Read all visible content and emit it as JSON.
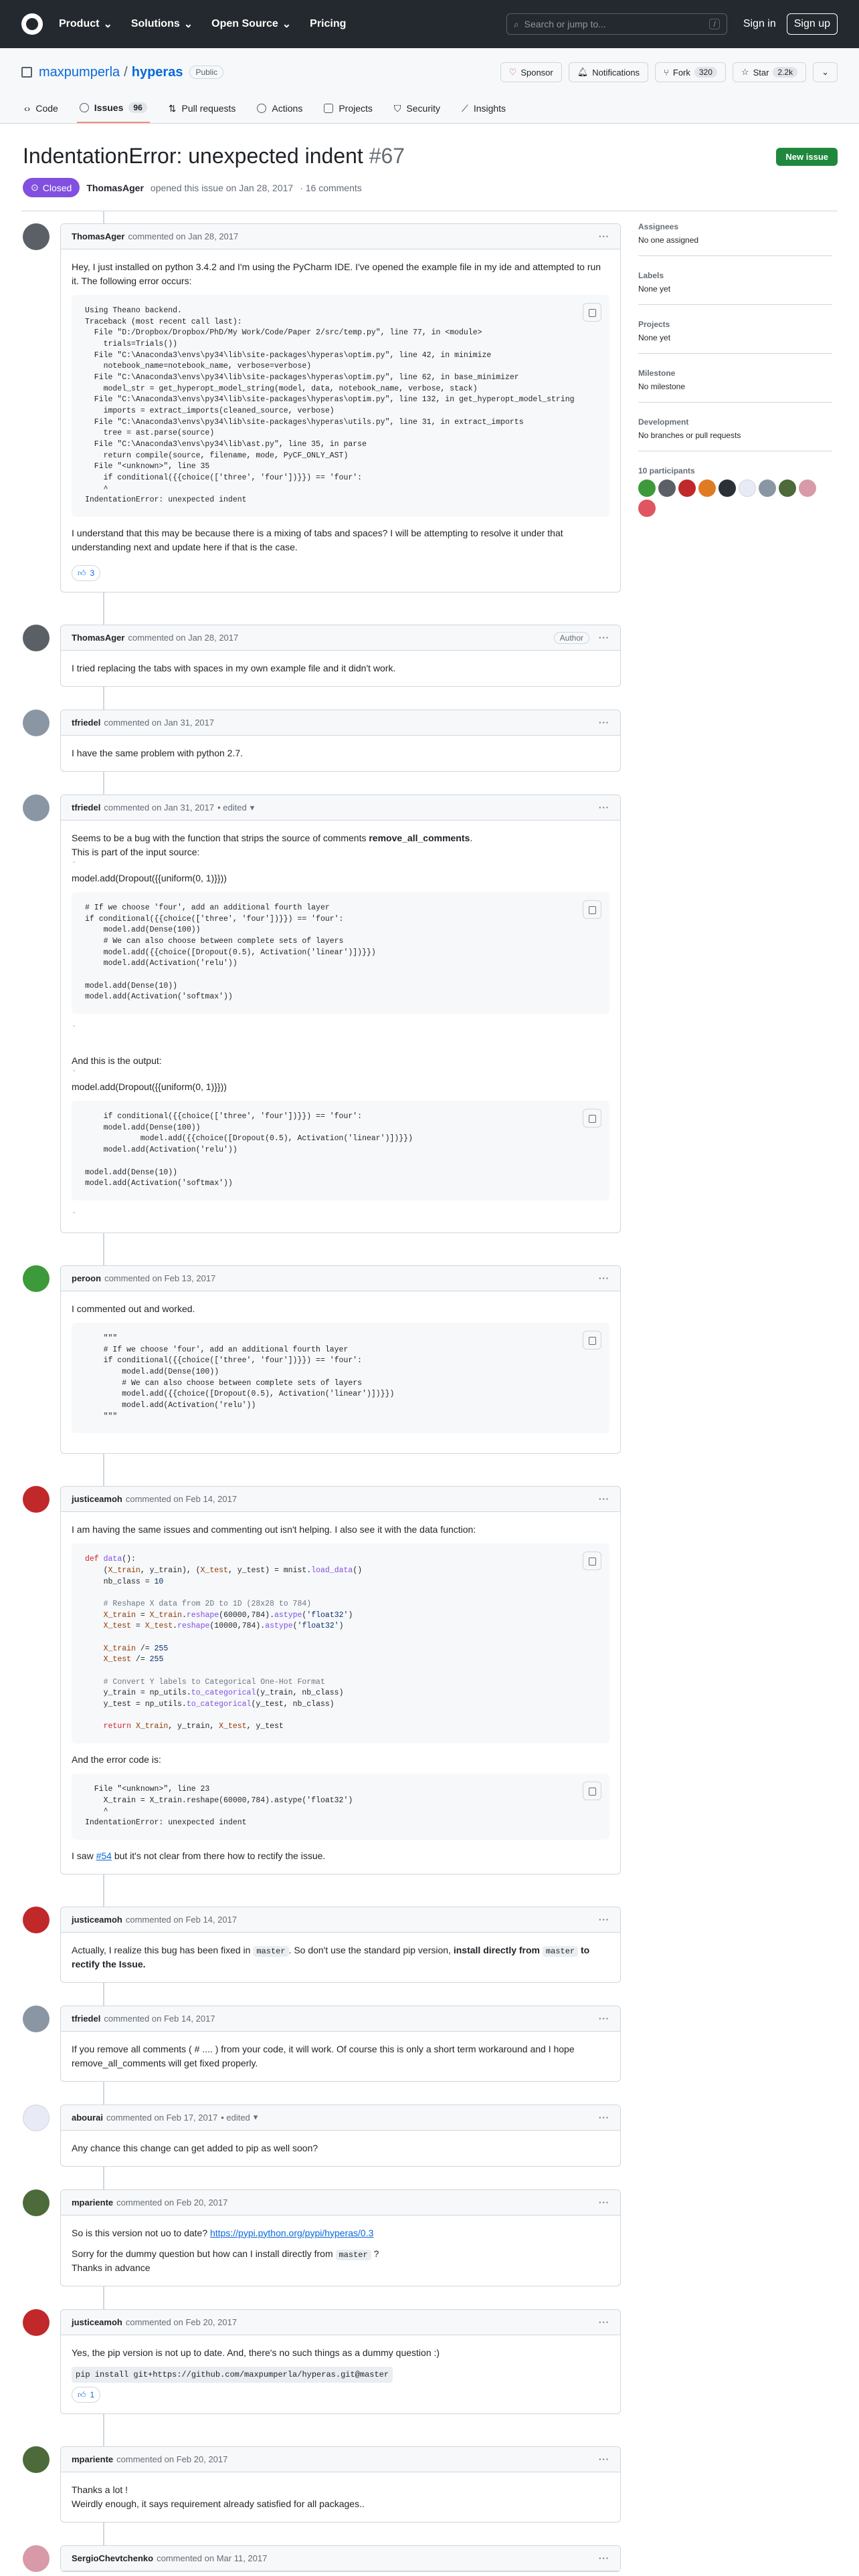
{
  "header": {
    "nav": [
      "Product",
      "Solutions",
      "Open Source",
      "Pricing"
    ],
    "search_placeholder": "Search or jump to...",
    "search_key": "/",
    "signin": "Sign in",
    "signup": "Sign up"
  },
  "repo": {
    "owner": "maxpumperla",
    "sep": "/",
    "name": "hyperas",
    "visibility": "Public",
    "sponsor": "Sponsor",
    "notifications": "Notifications",
    "fork": "Fork",
    "fork_count": "320",
    "star": "Star",
    "star_count": "2.2k",
    "tabs": [
      {
        "label": "Code"
      },
      {
        "label": "Issues",
        "count": "96"
      },
      {
        "label": "Pull requests"
      },
      {
        "label": "Actions"
      },
      {
        "label": "Projects"
      },
      {
        "label": "Security"
      },
      {
        "label": "Insights"
      }
    ]
  },
  "issue": {
    "title": "IndentationError: unexpected indent",
    "number": "#67",
    "state": "Closed",
    "author": "ThomasAger",
    "opened_text": "opened this issue on Jan 28, 2017",
    "comments_count": "· 16 comments",
    "new_issue": "New issue"
  },
  "comments": [
    {
      "author": "ThomasAger",
      "when": "commented on Jan 28, 2017",
      "p1": "Hey, I just installed on python 3.4.2 and I'm using the PyCharm IDE. I've opened the example file in my ide and attempted to run it. The following error occurs:",
      "code": "Using Theano backend.\nTraceback (most recent call last):\n  File \"D:/Dropbox/Dropbox/PhD/My Work/Code/Paper 2/src/temp.py\", line 77, in <module>\n    trials=Trials())\n  File \"C:\\Anaconda3\\envs\\py34\\lib\\site-packages\\hyperas\\optim.py\", line 42, in minimize\n    notebook_name=notebook_name, verbose=verbose)\n  File \"C:\\Anaconda3\\envs\\py34\\lib\\site-packages\\hyperas\\optim.py\", line 62, in base_minimizer\n    model_str = get_hyperopt_model_string(model, data, notebook_name, verbose, stack)\n  File \"C:\\Anaconda3\\envs\\py34\\lib\\site-packages\\hyperas\\optim.py\", line 132, in get_hyperopt_model_string\n    imports = extract_imports(cleaned_source, verbose)\n  File \"C:\\Anaconda3\\envs\\py34\\lib\\site-packages\\hyperas\\utils.py\", line 31, in extract_imports\n    tree = ast.parse(source)\n  File \"C:\\Anaconda3\\envs\\py34\\lib\\ast.py\", line 35, in parse\n    return compile(source, filename, mode, PyCF_ONLY_AST)\n  File \"<unknown>\", line 35\n    if conditional({{choice(['three', 'four'])}}) == 'four':\n    ^\nIndentationError: unexpected indent",
      "p2": "I understand that this may be because there is a mixing of tabs and spaces? I will be attempting to resolve it under that understanding next and update here if that is the case.",
      "reaction": "3"
    },
    {
      "author": "ThomasAger",
      "when": "commented on Jan 28, 2017",
      "badge": "Author",
      "p1": "I tried replacing the tabs with spaces in my own example file and it didn't work."
    },
    {
      "author": "tfriedel",
      "when": "commented on Jan 31, 2017",
      "p1": "I have the same problem with python 2.7."
    },
    {
      "author": "tfriedel",
      "when": "commented on Jan 31, 2017",
      "edited": "• edited",
      "p1_a": "Seems to be a bug with the function that strips the source of comments ",
      "p1_b": "remove_all_comments",
      "p1_c": ".",
      "p2": "This is part of the input source:",
      "tick": "`",
      "line1": "model.add(Dropout({{uniform(0, 1)}}))",
      "code1": "# If we choose 'four', add an additional fourth layer\nif conditional({{choice(['three', 'four'])}}) == 'four':\n    model.add(Dense(100))\n    # We can also choose between complete sets of layers\n    model.add({{choice([Dropout(0.5), Activation('linear')])}})\n    model.add(Activation('relu'))\n\nmodel.add(Dense(10))\nmodel.add(Activation('softmax'))",
      "p3": "And this is the output:",
      "line2": "model.add(Dropout({{uniform(0, 1)}}))",
      "code2": "    if conditional({{choice(['three', 'four'])}}) == 'four':\n    model.add(Dense(100))\n            model.add({{choice([Dropout(0.5), Activation('linear')])}})\n    model.add(Activation('relu'))\n\nmodel.add(Dense(10))\nmodel.add(Activation('softmax'))"
    },
    {
      "author": "peroon",
      "when": "commented on Feb 13, 2017",
      "p1": "I commented out and worked.",
      "code": "    \"\"\"\n    # If we choose 'four', add an additional fourth layer\n    if conditional({{choice(['three', 'four'])}}) == 'four':\n        model.add(Dense(100))\n        # We can also choose between complete sets of layers\n        model.add({{choice([Dropout(0.5), Activation('linear')])}})\n        model.add(Activation('relu'))\n    \"\"\""
    },
    {
      "author": "justiceamoh",
      "when": "commented on Feb 14, 2017",
      "p1": "I am having the same issues and commenting out isn't helping. I also see it with the data function:",
      "p2": "And the error code is:",
      "code2": "  File \"<unknown>\", line 23\n    X_train = X_train.reshape(60000,784).astype('float32')\n    ^\nIndentationError: unexpected indent",
      "p3_a": "I saw ",
      "p3_link": "#54",
      "p3_b": " but it's not clear from there how to rectify the issue."
    },
    {
      "author": "justiceamoh",
      "when": "commented on Feb 14, 2017",
      "p1_a": "Actually, I realize this bug has been fixed in ",
      "p1_code": "master",
      "p1_b": ". So don't use the standard pip version, ",
      "p1_bold": "install directly from",
      "p1_code2": "master",
      "p1_bold2": " to rectify the Issue."
    },
    {
      "author": "tfriedel",
      "when": "commented on Feb 14, 2017",
      "p1": "If you remove all comments ( # .... ) from your code, it will work. Of course this is only a short term workaround and I hope remove_all_comments will get fixed properly."
    },
    {
      "author": "abourai",
      "when": "commented on Feb 17, 2017",
      "edited": "• edited",
      "p1": "Any chance this change can get added to pip as well soon?"
    },
    {
      "author": "mpariente",
      "when": "commented on Feb 20, 2017",
      "p1_a": "So is this version not uo to date? ",
      "p1_link": "https://pypi.python.org/pypi/hyperas/0.3",
      "p2_a": "Sorry for the dummy question but how can I install directly from ",
      "p2_code": "master",
      "p2_b": " ?",
      "p3": "Thanks in advance"
    },
    {
      "author": "justiceamoh",
      "when": "commented on Feb 20, 2017",
      "p1": "Yes, the pip version is not up to date. And, there's no such things as a dummy question :)",
      "code": "pip install git+https://github.com/maxpumperla/hyperas.git@master",
      "reaction": "1"
    },
    {
      "author": "mpariente",
      "when": "commented on Feb 20, 2017",
      "p1": "Thanks a lot !",
      "p2": "Weirdly enough, it says requirement already satisfied for all packages.."
    },
    {
      "author": "SergioChevtchenko",
      "when": "commented on Mar 11, 2017"
    }
  ],
  "sidebar": {
    "assignees": "Assignees",
    "assignees_val": "No one assigned",
    "labels": "Labels",
    "labels_val": "None yet",
    "projects": "Projects",
    "projects_val": "None yet",
    "milestone": "Milestone",
    "milestone_val": "No milestone",
    "development": "Development",
    "development_val": "No branches or pull requests",
    "participants": "10 participants"
  },
  "colors": {
    "accent": "#0969da",
    "closed": "#8250df",
    "new_issue": "#1f883d",
    "header_bg": "#24292f"
  }
}
